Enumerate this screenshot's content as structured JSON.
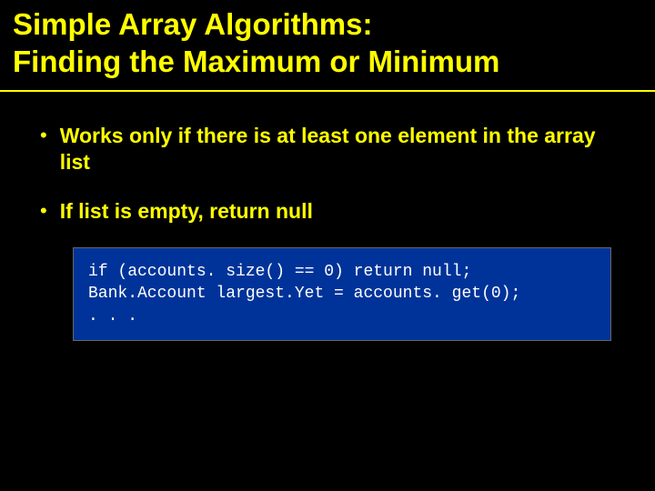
{
  "title": {
    "line1": "Simple Array Algorithms:",
    "line2": "Finding the Maximum or Minimum"
  },
  "bullets": [
    "Works only if there is at least one element in the array list",
    "If list is empty, return null"
  ],
  "code": {
    "line1": "if (accounts. size() == 0) return null;",
    "line2": "Bank.Account largest.Yet = accounts. get(0);",
    "line3": ". . ."
  }
}
